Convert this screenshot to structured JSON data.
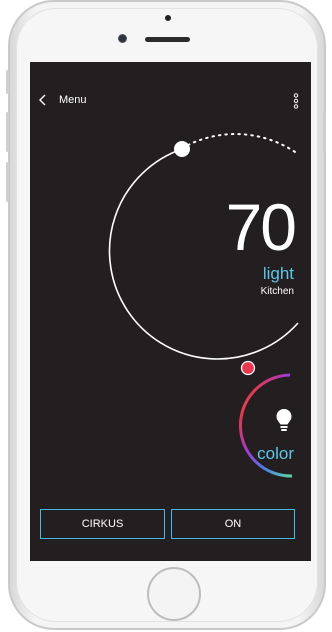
{
  "header": {
    "back_label": "Menu"
  },
  "thermostat": {
    "value": "70",
    "mode_label": "light",
    "room": "Kitchen",
    "level": 0.08
  },
  "color_control": {
    "label": "color",
    "icon": "lightbulb-icon"
  },
  "footer": {
    "scene_button_label": "CIRKUS",
    "power_button_label": "ON"
  },
  "colors": {
    "screen_bg": "#231f20",
    "accent_blue": "#5cc6e8",
    "button_border": "#46b7e0",
    "knob_red": "#e8374e"
  },
  "icons": [
    "chevron-left-icon",
    "more-vertical-icon",
    "lightbulb-icon"
  ]
}
